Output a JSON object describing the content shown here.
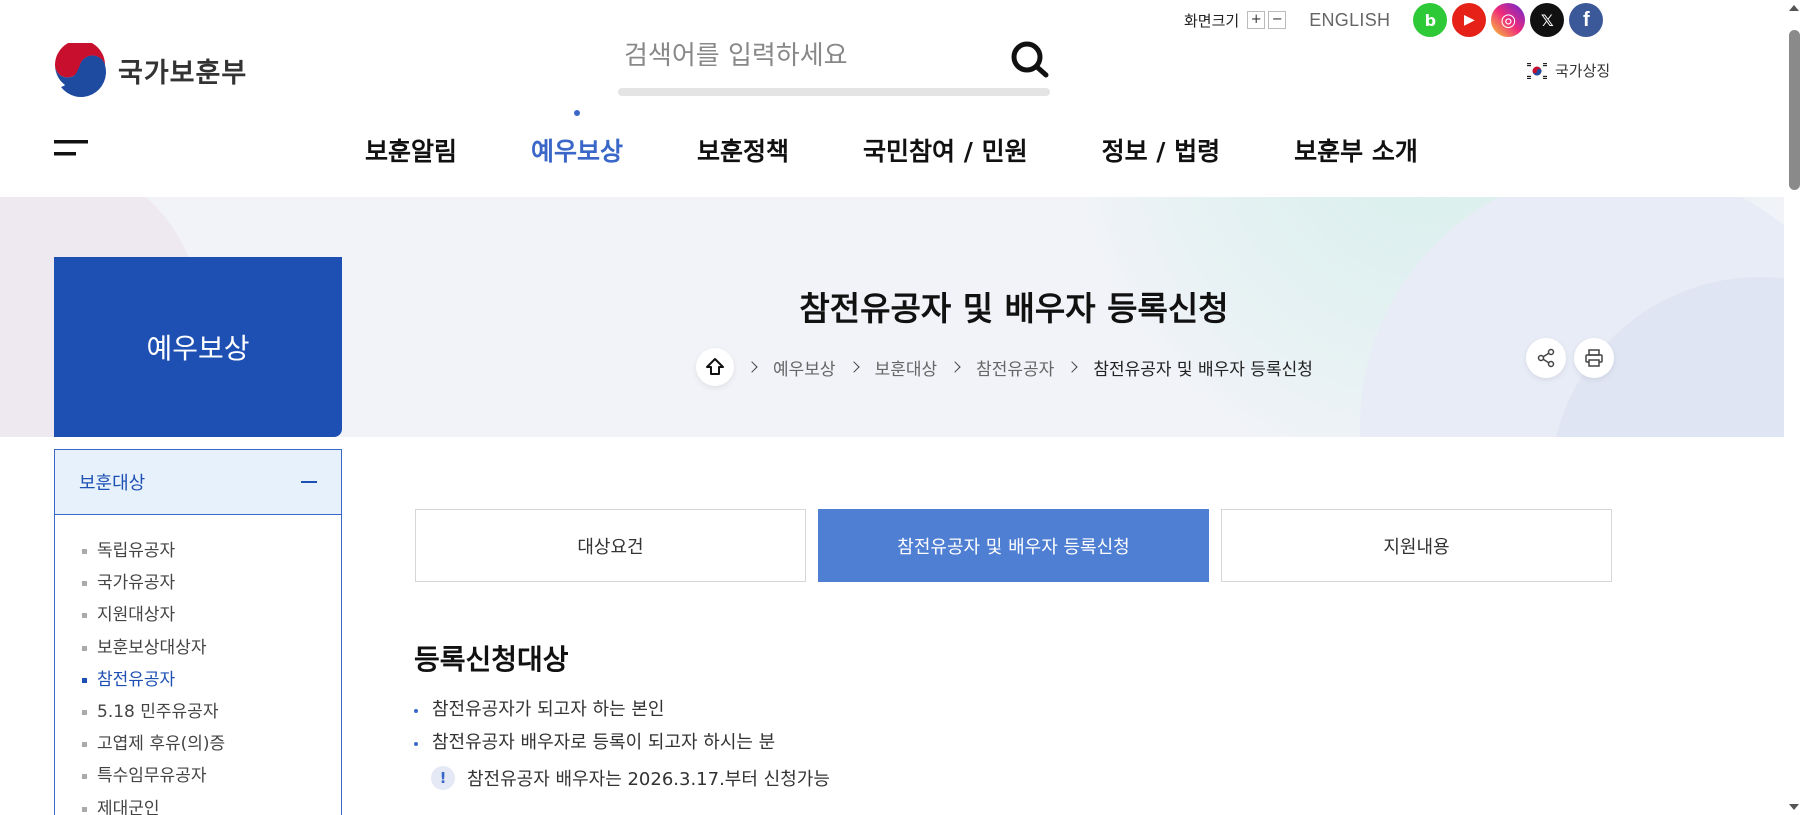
{
  "header": {
    "font_size_label": "화면크기",
    "font_plus": "+",
    "font_minus": "−",
    "language": "ENGLISH",
    "logo_text": "국가보훈부",
    "search_placeholder": "검색어를 입력하세요",
    "national_symbol_label": "국가상징",
    "sns": [
      {
        "name": "blog",
        "glyph": "b",
        "color": "#2dc937"
      },
      {
        "name": "youtube",
        "glyph": "▶",
        "color": "#e62117"
      },
      {
        "name": "instagram",
        "glyph": "◎",
        "color": "#d6249f"
      },
      {
        "name": "x",
        "glyph": "𝕏",
        "color": "#111111"
      },
      {
        "name": "facebook",
        "glyph": "f",
        "color": "#3b5998"
      }
    ]
  },
  "gnb": {
    "items": [
      {
        "label": "보훈알림",
        "active": false
      },
      {
        "label": "예우보상",
        "active": true
      },
      {
        "label": "보훈정책",
        "active": false
      },
      {
        "label": "국민참여 / 민원",
        "active": false
      },
      {
        "label": "정보 / 법령",
        "active": false
      },
      {
        "label": "보훈부 소개",
        "active": false
      }
    ]
  },
  "page": {
    "title": "참전유공자 및 배우자 등록신청",
    "breadcrumb": [
      "예우보상",
      "보훈대상",
      "참전유공자",
      "참전유공자 및 배우자 등록신청"
    ]
  },
  "lnb": {
    "title": "예우보상",
    "group": "보훈대상",
    "items": [
      {
        "label": "독립유공자",
        "active": false
      },
      {
        "label": "국가유공자",
        "active": false
      },
      {
        "label": "지원대상자",
        "active": false
      },
      {
        "label": "보훈보상대상자",
        "active": false
      },
      {
        "label": "참전유공자",
        "active": true
      },
      {
        "label": "5.18 민주유공자",
        "active": false
      },
      {
        "label": "고엽제 후유(의)증",
        "active": false
      },
      {
        "label": "특수임무유공자",
        "active": false
      },
      {
        "label": "제대군인",
        "active": false
      }
    ]
  },
  "tabs": [
    {
      "label": "대상요건",
      "active": false
    },
    {
      "label": "참전유공자 및 배우자 등록신청",
      "active": true
    },
    {
      "label": "지원내용",
      "active": false
    }
  ],
  "content": {
    "section_title": "등록신청대상",
    "bullets": [
      "참전유공자가 되고자 하는 본인",
      "참전유공자 배우자로 등록이 되고자 하시는 분"
    ],
    "notice_icon": "!",
    "notice": "참전유공자 배우자는 2026.3.17.부터 신청가능"
  },
  "colors": {
    "primary": "#1e50b4",
    "accent": "#3a67c8",
    "tab_active": "#4f7fd3",
    "band_bg": "#f1f3f8"
  }
}
